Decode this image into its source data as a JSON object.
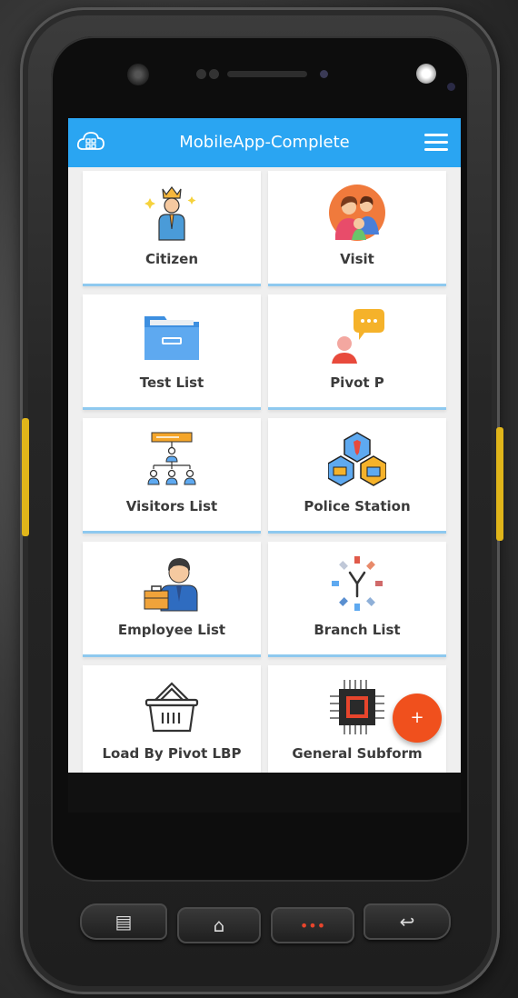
{
  "app": {
    "title": "MobileApp-Complete"
  },
  "tiles": [
    {
      "label": "Citizen",
      "icon": "citizen-icon"
    },
    {
      "label": "Visit",
      "icon": "visit-family-icon"
    },
    {
      "label": "Test List",
      "icon": "folder-icon"
    },
    {
      "label": "Pivot P",
      "icon": "chat-person-icon"
    },
    {
      "label": "Visitors List",
      "icon": "org-chart-icon"
    },
    {
      "label": "Police Station",
      "icon": "network-cubes-icon"
    },
    {
      "label": "Employee List",
      "icon": "employee-icon"
    },
    {
      "label": "Branch List",
      "icon": "branch-icon"
    },
    {
      "label": "Load By Pivot LBP",
      "icon": "basket-icon"
    },
    {
      "label": "General Subform",
      "icon": "chip-icon"
    }
  ],
  "fab": {
    "label": "+"
  },
  "hardware_buttons": {
    "menu": "▤",
    "home": "⌂",
    "more": "•••",
    "back": "↩"
  },
  "colors": {
    "app_bar": "#2aa5f2",
    "fab": "#f0501d",
    "device_accent": "#e0b51a"
  }
}
